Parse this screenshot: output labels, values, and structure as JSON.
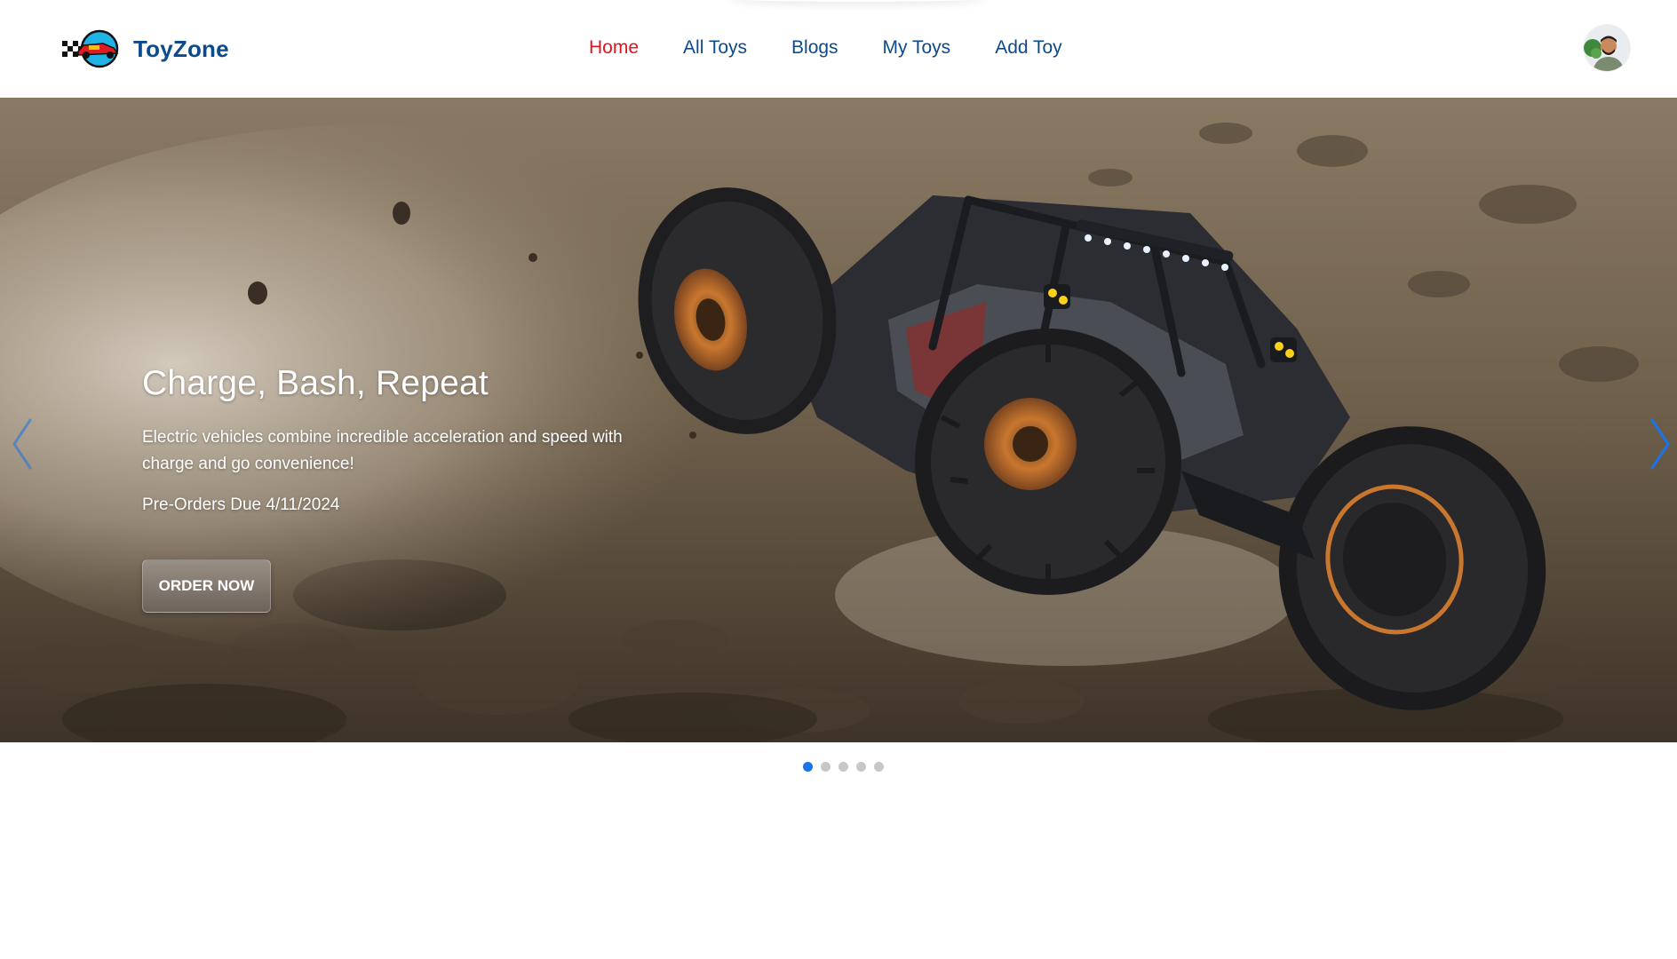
{
  "header": {
    "brand_name": "ToyZone",
    "nav": [
      {
        "label": "Home",
        "active": true
      },
      {
        "label": "All Toys",
        "active": false
      },
      {
        "label": "Blogs",
        "active": false
      },
      {
        "label": "My Toys",
        "active": false
      },
      {
        "label": "Add Toy",
        "active": false
      }
    ],
    "avatar_icon": "user-avatar"
  },
  "hero": {
    "slide_title": "Charge, Bash, Repeat",
    "slide_description": "Electric vehicles combine incredible acceleration and speed with charge and go convenience!",
    "preorder_text": "Pre-Orders Due 4/11/2024",
    "cta_label": "ORDER NOW",
    "prev_icon": "chevron-left-icon",
    "next_icon": "chevron-right-icon",
    "slide_count": 5,
    "active_slide": 1
  },
  "colors": {
    "brand_blue": "#0b4a8c",
    "nav_active_red": "#e5121e",
    "dot_active": "#1a73e8",
    "dot_inactive": "#c7c7c7"
  }
}
